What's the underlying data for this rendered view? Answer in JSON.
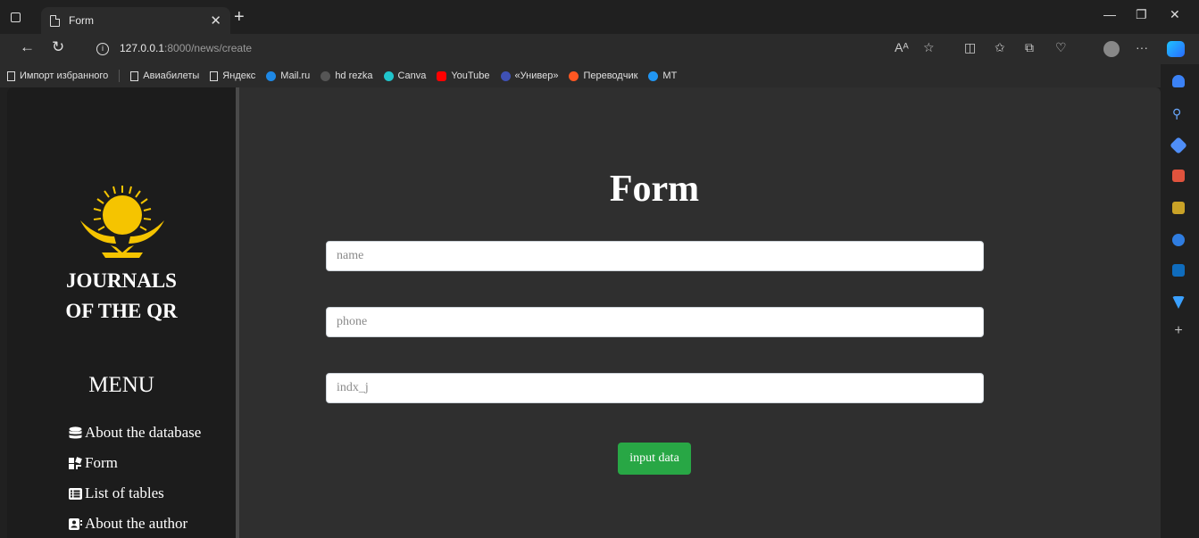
{
  "browser": {
    "tab_title": "Form",
    "url_host": "127.0.0.1",
    "url_rest": ":8000/news/create",
    "favorites": [
      {
        "label": "Импорт избранного",
        "color": "#cccccc"
      },
      {
        "label": "Авиабилеты",
        "color": "#cccccc"
      },
      {
        "label": "Яндекс",
        "color": "#cccccc"
      },
      {
        "label": "Mail.ru",
        "color": "#1e88e5"
      },
      {
        "label": "hd rezka",
        "color": "#555555"
      },
      {
        "label": "Canva",
        "color": "#20c4cb"
      },
      {
        "label": "YouTube",
        "color": "#ff0000"
      },
      {
        "label": "«Универ»",
        "color": "#3f51b5"
      },
      {
        "label": "Переводчик",
        "color": "#ff5722"
      },
      {
        "label": "MT",
        "color": "#2196f3"
      }
    ]
  },
  "sidebar": {
    "brand_line1": "JOURNALS",
    "brand_line2": "OF THE QR",
    "menu_title": "MENU",
    "items": [
      {
        "label": "About the database",
        "icon": "database-icon"
      },
      {
        "label": "Form",
        "icon": "form-icon"
      },
      {
        "label": "List of tables",
        "icon": "table-list-icon"
      },
      {
        "label": "About the author",
        "icon": "address-card-icon"
      }
    ]
  },
  "form": {
    "title": "Form",
    "fields": [
      {
        "placeholder": "name"
      },
      {
        "placeholder": "phone"
      },
      {
        "placeholder": "indx_j"
      }
    ],
    "submit_label": "input data"
  },
  "colors": {
    "submit_bg": "#28a745",
    "emblem": "#f5c400"
  }
}
